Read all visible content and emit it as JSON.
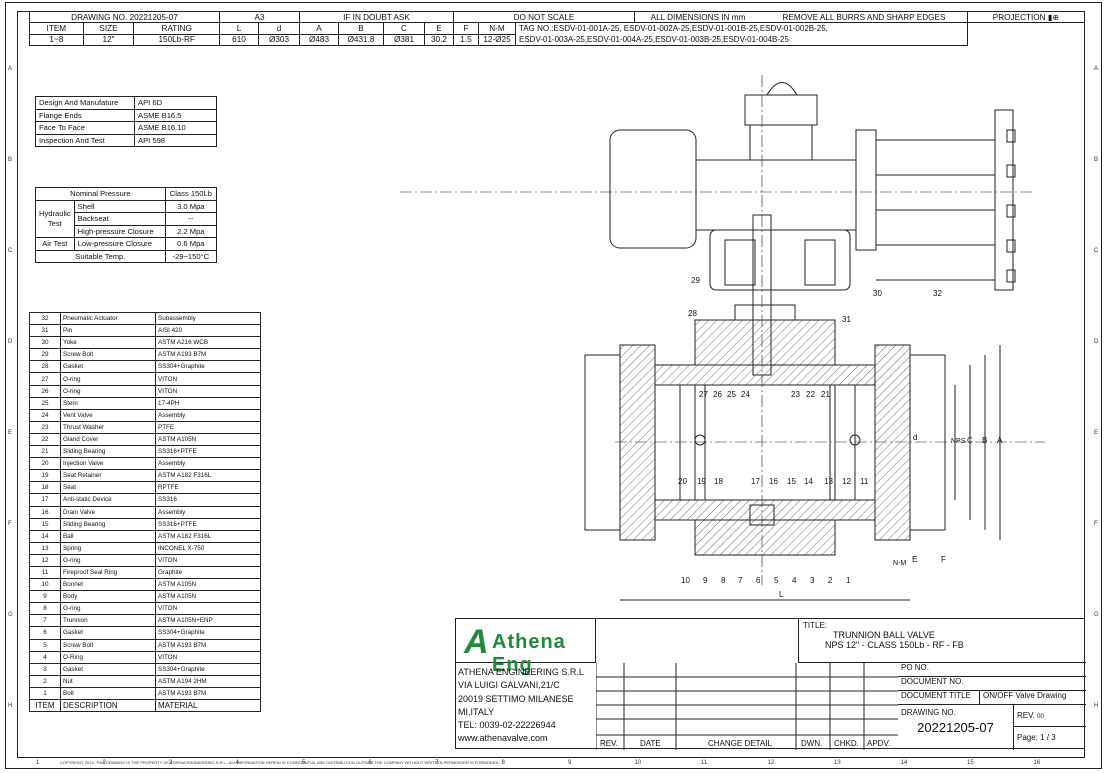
{
  "header": {
    "drawing_no_label": "DRAWING NO.",
    "drawing_no": "20221205-07",
    "sheet_size": "A3",
    "if_in_doubt": "IF IN DOUBT ASK",
    "do_not_scale": "DO NOT SCALE",
    "dimensions": "ALL DIMENSIONS IN mm",
    "remove_burrs": "REMOVE ALL BURRS AND SHARP EDGES",
    "projection": "PROJECTION",
    "columns": [
      "ITEM",
      "SIZE",
      "RATING",
      "L",
      "d",
      "A",
      "B",
      "C",
      "E",
      "F",
      "N-M"
    ],
    "values": [
      "1~8",
      "12\"",
      "150Lb-RF",
      "610",
      "Ø303",
      "Ø483",
      "Ø431.8",
      "Ø381",
      "30.2",
      "1.5",
      "12-Ø25"
    ],
    "tag_line1": "TAG NO.:ESDV-01-001A-25, ESDV-01-002A-25,ESDV-01-001B-25,ESDV-01-002B-25,",
    "tag_line2": "ESDV-01-003A-25,ESDV-01-004A-25,ESDV-01-003B-25,ESDV-01-004B-25"
  },
  "specs": [
    [
      "Design And Manufature",
      "API 6D"
    ],
    [
      "Flange Ends",
      "ASME B16.5"
    ],
    [
      "Face To Face",
      "ASME B16.10"
    ],
    [
      "Inspection And Test",
      "API 598"
    ]
  ],
  "pressure": {
    "nominal_label": "Nominal Pressure",
    "nominal_value": "Class 150Lb",
    "hydraulic": "Hydraulic Test",
    "shell": "Shell",
    "shell_value": "3.0 Mpa",
    "backseat": "Backseat",
    "backseat_value": "--",
    "hp_closure": "High-pressure Closure",
    "hp_value": "2.2 Mpa",
    "air_test": "Air Test",
    "lp_closure": "Low-pressure Closure",
    "lp_value": "0.6 Mpa",
    "temp_label": "Suitable Temp.",
    "temp_value": "-29~150°C"
  },
  "bom": [
    [
      "32",
      "Pneumatic Actuator",
      "Subassembly"
    ],
    [
      "31",
      "Pin",
      "AISI 420"
    ],
    [
      "30",
      "Yoke",
      "ASTM A216 WCB"
    ],
    [
      "29",
      "Screw Bolt",
      "ASTM A193 B7M"
    ],
    [
      "28",
      "Gasket",
      "SS304+Graphite"
    ],
    [
      "27",
      "O-ring",
      "VITON"
    ],
    [
      "26",
      "O-ring",
      "VITON"
    ],
    [
      "25",
      "Stem",
      "17-4PH"
    ],
    [
      "24",
      "Vent Valve",
      "Assembly"
    ],
    [
      "23",
      "Thrust Washer",
      "PTFE"
    ],
    [
      "22",
      "Gland Cover",
      "ASTM A105N"
    ],
    [
      "21",
      "Sliding Bearing",
      "SS316+PTFE"
    ],
    [
      "20",
      "Injection Valve",
      "Assembly"
    ],
    [
      "19",
      "Seat Retainer",
      "ASTM A182 F316L"
    ],
    [
      "18",
      "Seat",
      "RPTFE"
    ],
    [
      "17",
      "Anti-static Device",
      "SS316"
    ],
    [
      "16",
      "Drain Valve",
      "Assembly"
    ],
    [
      "15",
      "Sliding Bearing",
      "SS316+PTFE"
    ],
    [
      "14",
      "Ball",
      "ASTM A182 F316L"
    ],
    [
      "13",
      "Spring",
      "INCONEL X-750"
    ],
    [
      "12",
      "O-ring",
      "VITON"
    ],
    [
      "11",
      "Fireproof Seal Ring",
      "Graphite"
    ],
    [
      "10",
      "Bonnet",
      "ASTM A105N"
    ],
    [
      "9",
      "Body",
      "ASTM A105N"
    ],
    [
      "8",
      "O-ring",
      "VITON"
    ],
    [
      "7",
      "Trunnion",
      "ASTM A105N+ENP"
    ],
    [
      "6",
      "Gasket",
      "SS304+Graphite"
    ],
    [
      "5",
      "Screw Bolt",
      "ASTM A193 B7M"
    ],
    [
      "4",
      "O-Ring",
      "VITON"
    ],
    [
      "3",
      "Gasket",
      "SS304+Graphite"
    ],
    [
      "2",
      "Nut",
      "ASTM A194 2HM"
    ],
    [
      "1",
      "Bolt",
      "ASTM A193 B7M"
    ]
  ],
  "bom_header": [
    "ITEM",
    "DESCRIPTION",
    "MATERIAL"
  ],
  "title_block": {
    "logo_text": "Athena Eng",
    "company": [
      "ATHENA ENGINEERING S.R.L",
      "VIA LUIGI GALVANI,21/C",
      "20019 SETTIMO MILANESE",
      "MI,ITALY",
      "TEL: 0039-02-22226944",
      "www.athenavalve.com"
    ],
    "title_label": "TITLE:",
    "title_line1": "TRUNNION BALL VALVE",
    "title_line2": "NPS 12\" - CLASS 150Lb - RF - FB",
    "rev_cols": [
      "REV.",
      "DATE",
      "CHANGE DETAIL",
      "DWN.",
      "CHKD.",
      "APDV."
    ],
    "po_no": "PO NO.",
    "doc_no": "DOCUMENT NO.",
    "doc_title": "DOCUMENT TITLE",
    "doc_title_value": "ON/OFF Valve Drawing",
    "drawing_no": "DRAWING NO.",
    "drawing_no_value": "20221205-07",
    "rev_label": "REV.",
    "rev_value": "00",
    "page": "Page: 1 / 3"
  },
  "callouts": {
    "top": [
      "29",
      "28",
      "31",
      "30",
      "32"
    ],
    "middle": [
      "27",
      "26",
      "25",
      "24",
      "23",
      "22",
      "21"
    ],
    "lower": [
      "20",
      "19",
      "18",
      "17",
      "16",
      "15",
      "14",
      "13",
      "12",
      "11"
    ],
    "bottom": [
      "10",
      "9",
      "8",
      "7",
      "6",
      "5",
      "4",
      "3",
      "2",
      "1"
    ],
    "dims": [
      "d",
      "NPS",
      "C",
      "B",
      "A",
      "L",
      "N-M",
      "E",
      "F"
    ]
  },
  "zones_h": [
    "1",
    "2",
    "3",
    "4",
    "5",
    "6",
    "7",
    "8",
    "9",
    "10",
    "11",
    "12",
    "13",
    "14",
    "15",
    "16"
  ],
  "zones_v": [
    "A",
    "B",
    "C",
    "D",
    "E",
    "F",
    "G",
    "H"
  ],
  "footer": "COPYRIGHT 2014, THIS DRAWING IS THE PROPERTY OF ATHENA ENGINEERING S.R.L.. ALL INFORMATION HEREIN IS CONFIDENTIAL AND DISTRIBUTION OUTSIDE THE COMPANY WITHOUT WRITTEN PERMISSION IS FORBIDDEN.",
  "colors": {
    "logo_green": "#1f8a3a",
    "line": "#222222"
  }
}
